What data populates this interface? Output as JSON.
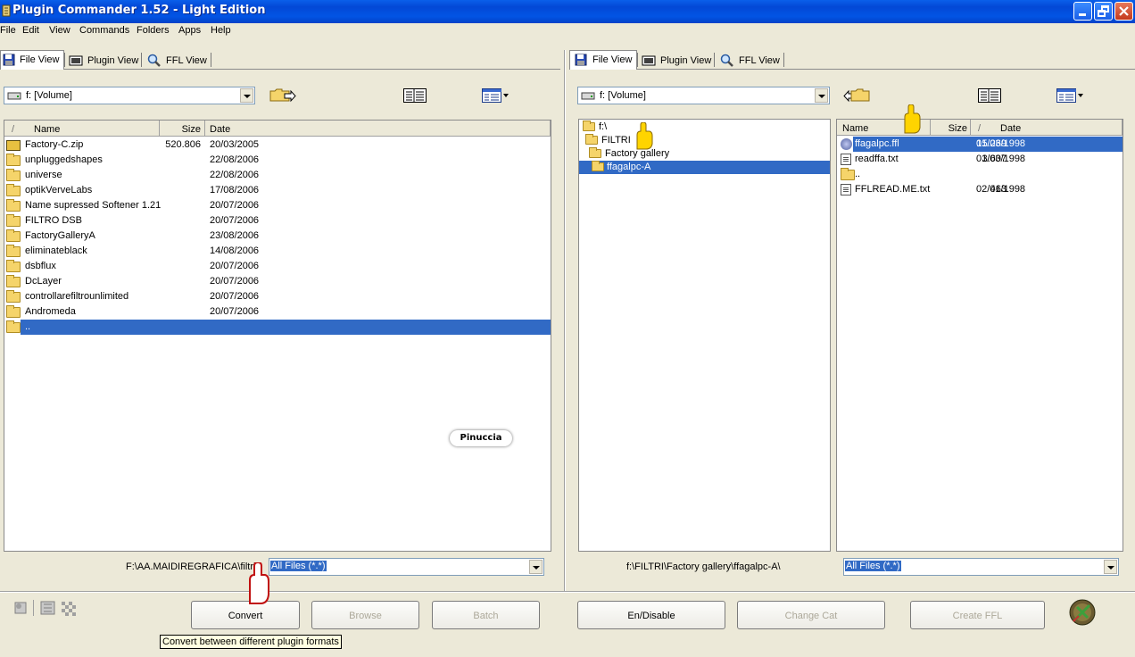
{
  "window": {
    "title": "Plugin Commander 1.52 - Light Edition"
  },
  "menu": [
    "File",
    "Edit",
    "View",
    "Commands",
    "Folders",
    "Apps",
    "Help"
  ],
  "tabs": [
    "File View",
    "Plugin View",
    "FFL View"
  ],
  "left": {
    "drive": "f: [Volume]",
    "columns": {
      "sort": "/",
      "name": "Name",
      "size": "Size",
      "date": "Date"
    },
    "files": [
      {
        "name": "Factory-C.zip",
        "size": "520.806",
        "date": "20/03/2005",
        "icon": "zip-icon"
      },
      {
        "name": "unpluggedshapes",
        "size": "",
        "date": "22/08/2006",
        "icon": "folder-icon"
      },
      {
        "name": "universe",
        "size": "",
        "date": "22/08/2006",
        "icon": "folder-icon"
      },
      {
        "name": "optikVerveLabs",
        "size": "",
        "date": "17/08/2006",
        "icon": "folder-icon"
      },
      {
        "name": "Name supressed Softener 1.21",
        "size": "",
        "date": "20/07/2006",
        "icon": "folder-icon"
      },
      {
        "name": "FILTRO DSB",
        "size": "",
        "date": "20/07/2006",
        "icon": "folder-icon"
      },
      {
        "name": "FactoryGalleryA",
        "size": "",
        "date": "23/08/2006",
        "icon": "folder-icon"
      },
      {
        "name": "eliminateblack",
        "size": "",
        "date": "14/08/2006",
        "icon": "folder-icon"
      },
      {
        "name": "dsbflux",
        "size": "",
        "date": "20/07/2006",
        "icon": "folder-icon"
      },
      {
        "name": "DcLayer",
        "size": "",
        "date": "20/07/2006",
        "icon": "folder-icon"
      },
      {
        "name": "controllarefiltrounlimited",
        "size": "",
        "date": "20/07/2006",
        "icon": "folder-icon"
      },
      {
        "name": "Andromeda",
        "size": "",
        "date": "20/07/2006",
        "icon": "folder-icon"
      },
      {
        "name": "..",
        "size": "",
        "date": "",
        "icon": "parent-folder-icon"
      }
    ],
    "path": "F:\\AA.MAIDIREGRAFICA\\filtri\\",
    "filter": "All Files (*.*)"
  },
  "right": {
    "drive": "f: [Volume]",
    "tree": [
      "f:\\",
      "FILTRI",
      "Factory gallery",
      "ffagalpc-A"
    ],
    "columns": {
      "name": "Name",
      "size": "Size",
      "sort": "/",
      "date": "Date"
    },
    "files": [
      {
        "name": "ffagalpc.ffl",
        "size": "15.269",
        "date": "01/03/1998",
        "icon": "ffl-icon"
      },
      {
        "name": "readffa.txt",
        "size": "3.607",
        "date": "01/03/1998",
        "icon": "text-file-icon"
      },
      {
        "name": "..",
        "size": "",
        "date": "",
        "icon": "parent-folder-icon"
      },
      {
        "name": "FFLREAD.ME.txt",
        "size": "463",
        "date": "02/01/1998",
        "icon": "text-file-icon"
      }
    ],
    "path": "f:\\FILTRI\\Factory gallery\\ffagalpc-A\\",
    "filter": "All Files (*.*)"
  },
  "buttons": {
    "convert": "Convert",
    "browse": "Browse",
    "batch": "Batch",
    "endisable": "En/Disable",
    "change_cat": "Change Cat",
    "create_ffl": "Create FFL"
  },
  "tooltip": "Convert between different plugin formats",
  "watermark": "Pinuccia"
}
